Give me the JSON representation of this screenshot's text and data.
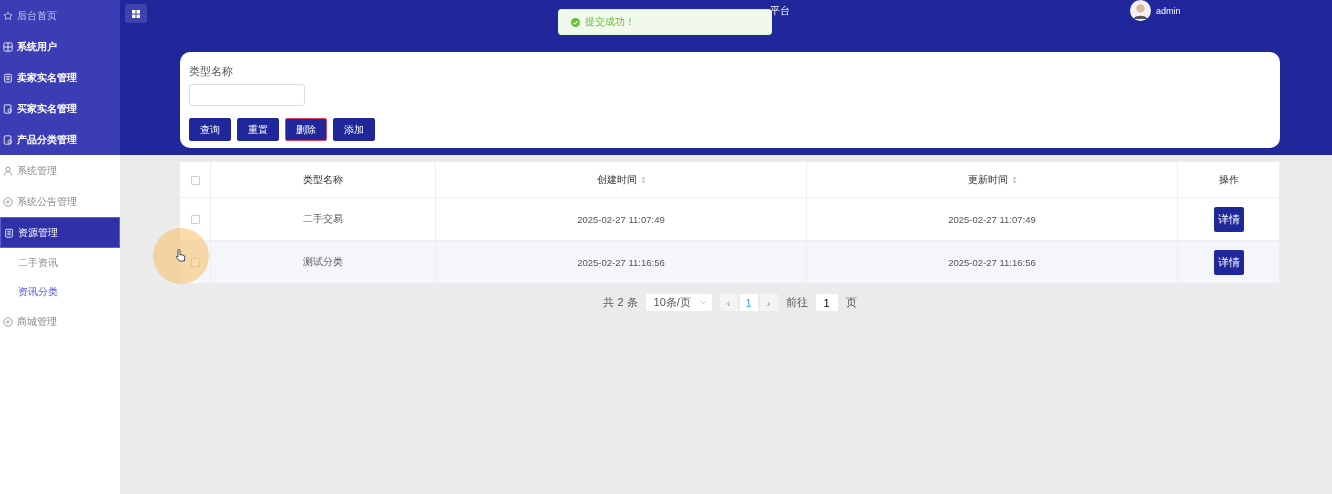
{
  "sidebar": {
    "items": [
      {
        "label": "后台首页",
        "kind": "top",
        "selected": false
      },
      {
        "label": "系统用户",
        "kind": "top",
        "selected": false
      },
      {
        "label": "卖家实名管理",
        "kind": "top",
        "selected": false
      },
      {
        "label": "买家实名管理",
        "kind": "top",
        "selected": false
      },
      {
        "label": "产品分类管理",
        "kind": "top",
        "selected": false
      },
      {
        "label": "系统管理",
        "kind": "plain",
        "selected": false
      },
      {
        "label": "系统公告管理",
        "kind": "plain",
        "selected": false
      },
      {
        "label": "资源管理",
        "kind": "plain",
        "selected": true,
        "children": [
          {
            "label": "二手资讯",
            "selected": false
          },
          {
            "label": "资讯分类",
            "selected": true
          }
        ]
      },
      {
        "label": "商城管理",
        "kind": "plain",
        "selected": false
      }
    ]
  },
  "header": {
    "title": "平台",
    "user": "admin"
  },
  "toast": {
    "message": "提交成功！"
  },
  "search": {
    "label": "类型名称",
    "buttons": [
      {
        "label": "查询",
        "kind": "normal"
      },
      {
        "label": "重置",
        "kind": "normal"
      },
      {
        "label": "删除",
        "kind": "danger"
      },
      {
        "label": "添加",
        "kind": "normal"
      }
    ]
  },
  "table": {
    "select_all": false,
    "columns": [
      {
        "label": "类型名称",
        "sortable": false
      },
      {
        "label": "创建时间",
        "sortable": true
      },
      {
        "label": "更新时间",
        "sortable": true
      },
      {
        "label": "操作",
        "sortable": false
      }
    ],
    "rows": [
      {
        "checked": false,
        "name": "二手交易",
        "created": "2025-02-27 11:07:49",
        "updated": "2025-02-27 11:07:49",
        "action": "详情"
      },
      {
        "checked": false,
        "name": "测试分类",
        "created": "2025-02-27 11:16:56",
        "updated": "2025-02-27 11:16:56",
        "action": "详情"
      }
    ]
  },
  "pagination": {
    "total": "共 2 条",
    "page_size": "10条/页",
    "prev": "‹",
    "page": "1",
    "next": "›",
    "goto_label": "前往",
    "goto_value": "1",
    "goto_suffix": "页"
  }
}
